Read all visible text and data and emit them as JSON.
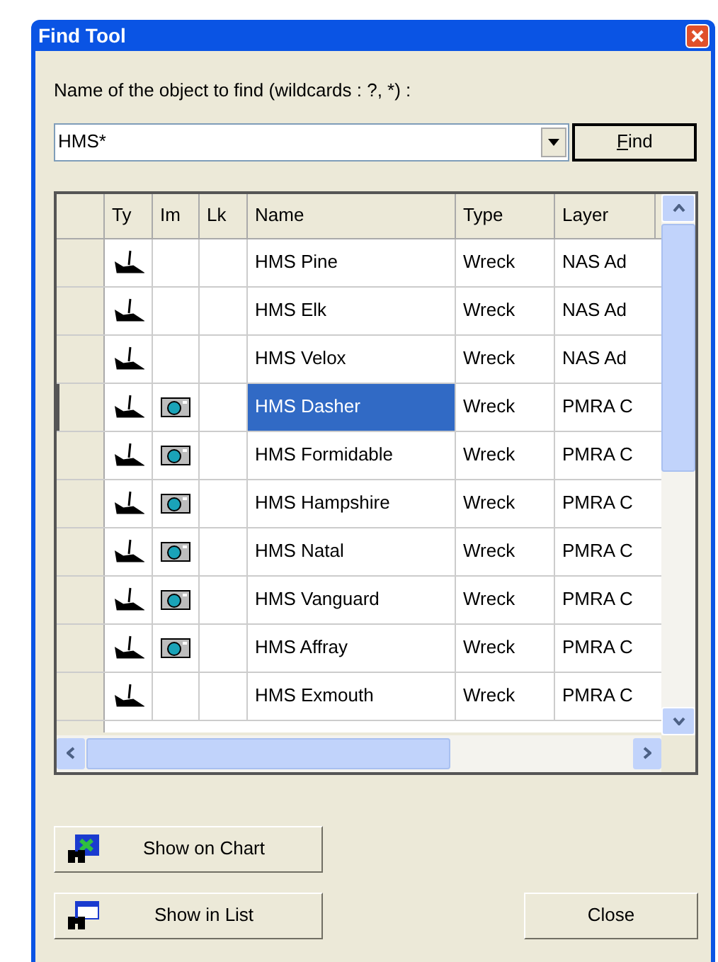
{
  "window": {
    "title": "Find Tool"
  },
  "search": {
    "label": "Name of the object to find (wildcards : ?, *) :",
    "value": "HMS*",
    "find_button": "Find"
  },
  "table": {
    "columns": [
      "Ty",
      "Im",
      "Lk",
      "Name",
      "Type",
      "Layer"
    ],
    "rows": [
      {
        "name": "HMS Pine",
        "type": "Wreck",
        "layer": "NAS Ad",
        "has_image": false,
        "selected": false
      },
      {
        "name": "HMS Elk",
        "type": "Wreck",
        "layer": "NAS Ad",
        "has_image": false,
        "selected": false
      },
      {
        "name": "HMS Velox",
        "type": "Wreck",
        "layer": "NAS Ad",
        "has_image": false,
        "selected": false
      },
      {
        "name": "HMS Dasher",
        "type": "Wreck",
        "layer": "PMRA C",
        "has_image": true,
        "selected": true
      },
      {
        "name": "HMS Formidable",
        "type": "Wreck",
        "layer": "PMRA C",
        "has_image": true,
        "selected": false
      },
      {
        "name": "HMS Hampshire",
        "type": "Wreck",
        "layer": "PMRA C",
        "has_image": true,
        "selected": false
      },
      {
        "name": "HMS Natal",
        "type": "Wreck",
        "layer": "PMRA C",
        "has_image": true,
        "selected": false
      },
      {
        "name": "HMS Vanguard",
        "type": "Wreck",
        "layer": "PMRA C",
        "has_image": true,
        "selected": false
      },
      {
        "name": "HMS Affray",
        "type": "Wreck",
        "layer": "PMRA C",
        "has_image": true,
        "selected": false
      },
      {
        "name": "HMS Exmouth",
        "type": "Wreck",
        "layer": "PMRA C",
        "has_image": false,
        "selected": false
      }
    ]
  },
  "buttons": [
    {
      "label": "Show on Chart",
      "kind": "chart"
    },
    {
      "label": "Show in List",
      "kind": "list"
    }
  ],
  "close_button": "Close"
}
